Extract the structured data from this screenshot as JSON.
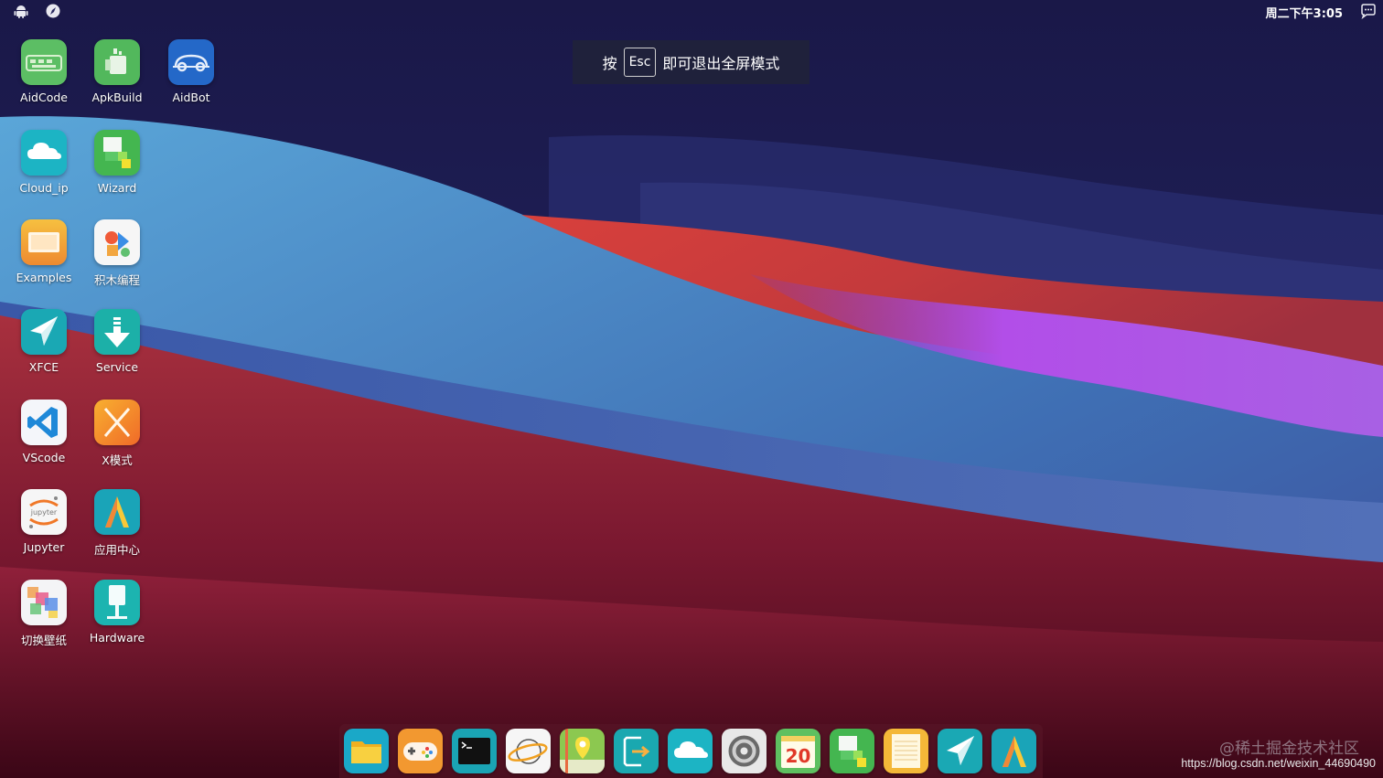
{
  "status_bar": {
    "left_icons": [
      "android-icon",
      "compass-icon"
    ],
    "clock": "周二下午3:05",
    "right_icon": "chat-icon"
  },
  "fullscreen_notice": {
    "prefix": "按",
    "key": "Esc",
    "suffix": "即可退出全屏模式"
  },
  "desktop_icons": [
    {
      "label": "AidCode",
      "icon": "aidcode-icon"
    },
    {
      "label": "ApkBuild",
      "icon": "apkbuild-icon"
    },
    {
      "label": "AidBot",
      "icon": "aidbot-icon"
    },
    {
      "label": "Cloud_ip",
      "icon": "cloud-icon"
    },
    {
      "label": "Wizard",
      "icon": "wizard-icon"
    },
    {
      "label": "Examples",
      "icon": "examples-icon"
    },
    {
      "label": "积木编程",
      "icon": "blocks-icon"
    },
    {
      "label": "XFCE",
      "icon": "send-icon"
    },
    {
      "label": "Service",
      "icon": "download-icon"
    },
    {
      "label": "VScode",
      "icon": "vscode-icon"
    },
    {
      "label": "X模式",
      "icon": "x-mode-icon"
    },
    {
      "label": "Jupyter",
      "icon": "jupyter-icon"
    },
    {
      "label": "应用中心",
      "icon": "app-center-icon"
    },
    {
      "label": "切换壁纸",
      "icon": "wallpaper-icon"
    },
    {
      "label": "Hardware",
      "icon": "hardware-icon"
    }
  ],
  "dock": [
    {
      "icon": "files-icon"
    },
    {
      "icon": "gamepad-icon"
    },
    {
      "icon": "terminal-icon"
    },
    {
      "icon": "browser-icon"
    },
    {
      "icon": "maps-icon"
    },
    {
      "icon": "exit-icon"
    },
    {
      "icon": "cloud-icon"
    },
    {
      "icon": "settings-icon"
    },
    {
      "icon": "calendar-icon",
      "text": "20"
    },
    {
      "icon": "wizard-icon"
    },
    {
      "icon": "notes-icon"
    },
    {
      "icon": "send-icon"
    },
    {
      "icon": "app-center-icon"
    }
  ],
  "jupyter_text": "jupyter",
  "watermark": {
    "brand": "@稀土掘金技术社区",
    "url": "https://blog.csdn.net/weixin_44690490"
  },
  "colors": {
    "sky": "#1c1c52",
    "blue_dune": "#4a8ec8",
    "red_dune": "#c8363c",
    "purple_dune": "#b050e8",
    "dark_red": "#4a0a20"
  }
}
